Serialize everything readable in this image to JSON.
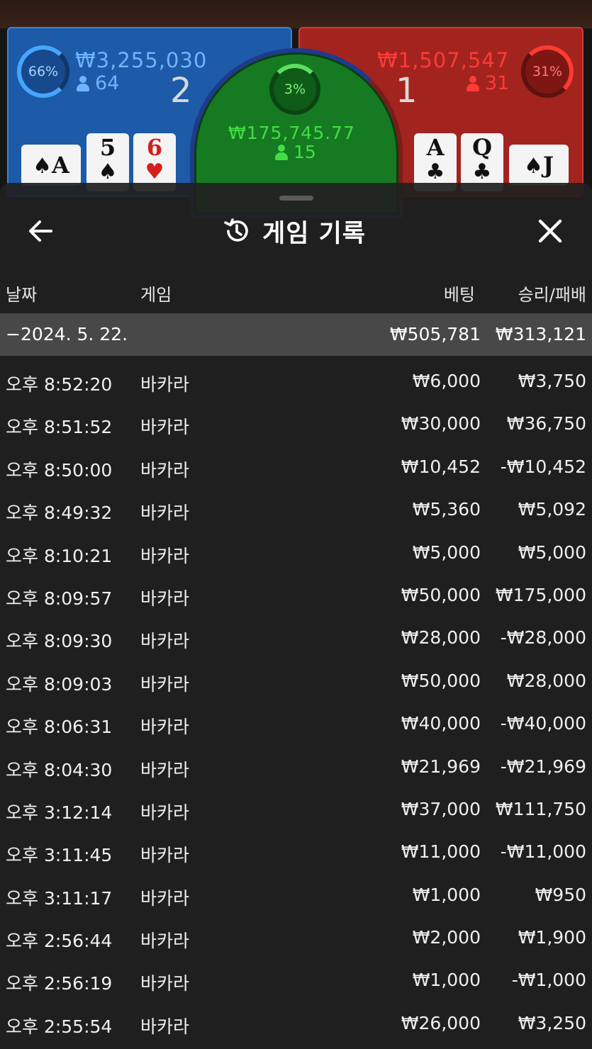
{
  "table": {
    "player": {
      "percent": "66%",
      "amount": "₩3,255,030",
      "count": "64",
      "score": "2",
      "cards": [
        {
          "rank": "A",
          "suit": "♠",
          "color": "black",
          "side": true
        },
        {
          "rank": "5",
          "suit": "♠",
          "color": "black"
        },
        {
          "rank": "6",
          "suit": "♥",
          "color": "red"
        }
      ]
    },
    "tie": {
      "percent": "3%",
      "amount": "₩175,745.77",
      "count": "15"
    },
    "banker": {
      "percent": "31%",
      "amount": "₩1,507,547",
      "count": "31",
      "score": "1",
      "cards": [
        {
          "rank": "A",
          "suit": "♣",
          "color": "black"
        },
        {
          "rank": "Q",
          "suit": "♣",
          "color": "black"
        },
        {
          "rank": "J",
          "suit": "♠",
          "color": "black",
          "side": true
        }
      ]
    },
    "colors": {
      "player": "#1d5aa8",
      "banker": "#a3231f",
      "tie": "#157a22"
    }
  },
  "modal": {
    "title": "게임 기록",
    "back_icon": "back-arrow-icon",
    "history_icon": "history-icon",
    "close_icon": "close-icon",
    "columns": {
      "date": "날짜",
      "game": "게임",
      "bet": "베팅",
      "result": "승리/패배"
    },
    "day": {
      "label": "−2024. 5. 22.",
      "bet_total": "₩505,781",
      "result_total": "₩313,121"
    },
    "rows": [
      {
        "time": "오후 8:52:20",
        "game": "바카라",
        "bet": "₩6,000",
        "result": "₩3,750"
      },
      {
        "time": "오후 8:51:52",
        "game": "바카라",
        "bet": "₩30,000",
        "result": "₩36,750"
      },
      {
        "time": "오후 8:50:00",
        "game": "바카라",
        "bet": "₩10,452",
        "result": "-₩10,452"
      },
      {
        "time": "오후 8:49:32",
        "game": "바카라",
        "bet": "₩5,360",
        "result": "₩5,092"
      },
      {
        "time": "오후 8:10:21",
        "game": "바카라",
        "bet": "₩5,000",
        "result": "₩5,000"
      },
      {
        "time": "오후 8:09:57",
        "game": "바카라",
        "bet": "₩50,000",
        "result": "₩175,000"
      },
      {
        "time": "오후 8:09:30",
        "game": "바카라",
        "bet": "₩28,000",
        "result": "-₩28,000"
      },
      {
        "time": "오후 8:09:03",
        "game": "바카라",
        "bet": "₩50,000",
        "result": "₩28,000"
      },
      {
        "time": "오후 8:06:31",
        "game": "바카라",
        "bet": "₩40,000",
        "result": "-₩40,000"
      },
      {
        "time": "오후 8:04:30",
        "game": "바카라",
        "bet": "₩21,969",
        "result": "-₩21,969"
      },
      {
        "time": "오후 3:12:14",
        "game": "바카라",
        "bet": "₩37,000",
        "result": "₩111,750"
      },
      {
        "time": "오후 3:11:45",
        "game": "바카라",
        "bet": "₩11,000",
        "result": "-₩11,000"
      },
      {
        "time": "오후 3:11:17",
        "game": "바카라",
        "bet": "₩1,000",
        "result": "₩950"
      },
      {
        "time": "오후 2:56:44",
        "game": "바카라",
        "bet": "₩2,000",
        "result": "₩1,900"
      },
      {
        "time": "오후 2:56:19",
        "game": "바카라",
        "bet": "₩1,000",
        "result": "-₩1,000"
      },
      {
        "time": "오후 2:55:54",
        "game": "바카라",
        "bet": "₩26,000",
        "result": "₩3,250"
      }
    ]
  }
}
